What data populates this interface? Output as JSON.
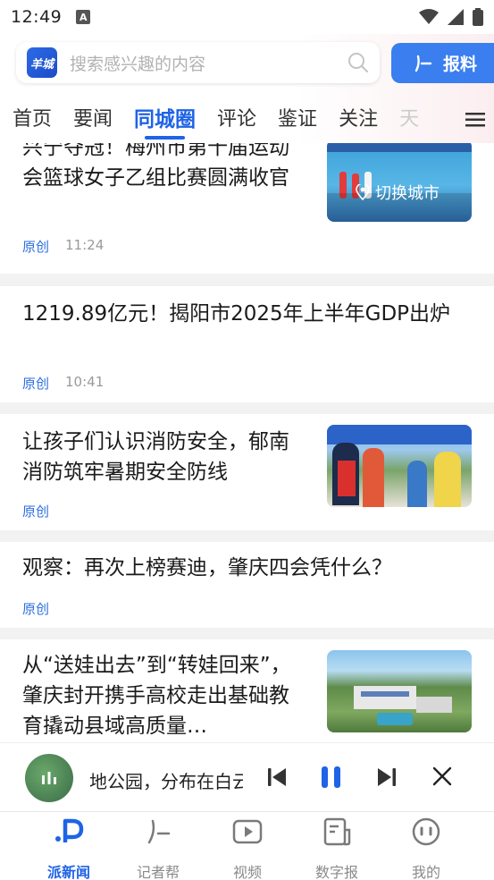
{
  "status": {
    "time": "12:49",
    "indicator": "A"
  },
  "search": {
    "logo": "羊城",
    "placeholder": "搜索感兴趣的内容",
    "report_label": "报料"
  },
  "tabs": [
    {
      "label": "首页"
    },
    {
      "label": "要闻"
    },
    {
      "label": "同城圈"
    },
    {
      "label": "评论"
    },
    {
      "label": "鉴证"
    },
    {
      "label": "关注"
    },
    {
      "label": "天"
    }
  ],
  "feed": [
    {
      "title": "兴宁夺冠！梅州市第十届运动会篮球女子乙组比赛圆满收官",
      "tag": "原创",
      "time": "11:24",
      "thumb_overlay": "切换城市"
    },
    {
      "title": "1219.89亿元！揭阳市2025年上半年GDP出炉",
      "tag": "原创",
      "time": "10:41"
    },
    {
      "title": "让孩子们认识消防安全，郁南消防筑牢暑期安全防线",
      "tag": "原创",
      "time": ""
    },
    {
      "title": "观察：再次上榜赛迪，肇庆四会凭什么？",
      "tag": "原创",
      "time": ""
    },
    {
      "title": "从“送娃出去”到“转娃回来”，肇庆封开携手高校走出基础教育撬动县域高质量…",
      "tag": "",
      "time": ""
    }
  ],
  "player": {
    "text": "地公园，分布在白云"
  },
  "nav": [
    {
      "label": "派新闻",
      "icon": "pai-logo-icon"
    },
    {
      "label": "记者帮",
      "icon": "reporter-icon"
    },
    {
      "label": "视频",
      "icon": "video-icon"
    },
    {
      "label": "数字报",
      "icon": "newspaper-icon"
    },
    {
      "label": "我的",
      "icon": "profile-icon"
    }
  ],
  "colors": {
    "accent": "#1f63e6",
    "tag": "#2c6fe0",
    "report_button": "#3a7ef0"
  }
}
